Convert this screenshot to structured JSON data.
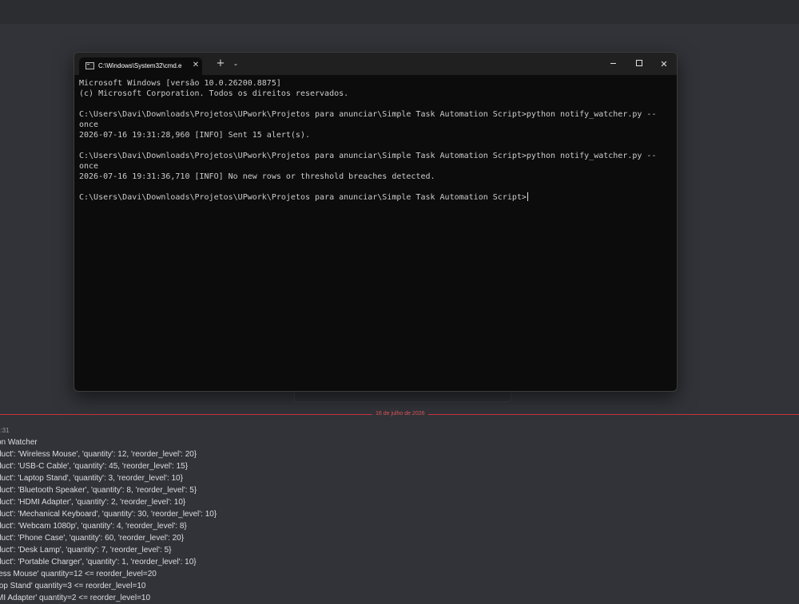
{
  "terminal": {
    "tab_title": "C:\\Windows\\System32\\cmd.e",
    "tab_close": "✕",
    "new_tab": "+",
    "dropdown": "⌄",
    "lines": [
      "Microsoft Windows [versão 10.0.26200.8875]",
      "(c) Microsoft Corporation. Todos os direitos reservados.",
      "",
      "C:\\Users\\Davi\\Downloads\\Projetos\\UPwork\\Projetos para anunciar\\Simple Task Automation Script>python notify_watcher.py --",
      "once",
      "2026-07-16 19:31:28,960 [INFO] Sent 15 alert(s).",
      "",
      "C:\\Users\\Davi\\Downloads\\Projetos\\UPwork\\Projetos para anunciar\\Simple Task Automation Script>python notify_watcher.py --",
      "once",
      "2026-07-16 19:31:36,710 [INFO] No new rows or threshold breaches detected.",
      "",
      "C:\\Users\\Davi\\Downloads\\Projetos\\UPwork\\Projetos para anunciar\\Simple Task Automation Script>"
    ]
  },
  "chat": {
    "date_divider": "16 de julho de 2026",
    "timestamp": "9:31",
    "lines": [
      "on Watcher",
      "duct': 'Wireless Mouse', 'quantity': 12, 'reorder_level': 20}",
      "duct': 'USB-C Cable', 'quantity': 45, 'reorder_level': 15}",
      "duct': 'Laptop Stand', 'quantity': 3, 'reorder_level': 10}",
      "duct': 'Bluetooth Speaker', 'quantity': 8, 'reorder_level': 5}",
      "duct': 'HDMI Adapter', 'quantity': 2, 'reorder_level': 10}",
      "duct': 'Mechanical Keyboard', 'quantity': 30, 'reorder_level': 10}",
      "duct': 'Webcam 1080p', 'quantity': 4, 'reorder_level': 8}",
      "duct': 'Phone Case', 'quantity': 60, 'reorder_level': 20}",
      "duct': 'Desk Lamp', 'quantity': 7, 'reorder_level': 5}",
      "duct': 'Portable Charger', 'quantity': 1, 'reorder_level': 10}",
      "less Mouse' quantity=12 <= reorder_level=20",
      "top Stand' quantity=3 <= reorder_level=10",
      "MI Adapter' quantity=2 <= reorder_level=10"
    ]
  }
}
